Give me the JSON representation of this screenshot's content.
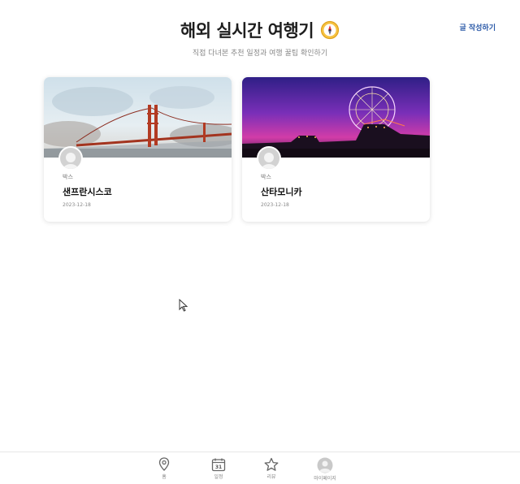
{
  "header": {
    "title": "해외 실시간 여행기",
    "subtitle": "직접 다녀본 추천 일정과 여행 꿀팁 확인하기",
    "write_link": "글 작성하기"
  },
  "cards": [
    {
      "author": "박스",
      "title": "샌프란시스코",
      "date": "2023-12-18"
    },
    {
      "author": "박스",
      "title": "산타모니카",
      "date": "2023-12-18"
    }
  ],
  "nav": [
    {
      "label": "홈",
      "icon": "map-pin-icon"
    },
    {
      "label": "일정",
      "icon": "calendar-icon"
    },
    {
      "label": "리뷰",
      "icon": "star-icon"
    },
    {
      "label": "마이페이지",
      "icon": "profile-icon"
    }
  ],
  "calendar_day": "31",
  "colors": {
    "accent": "#2b5aa8",
    "compass": "#f2b530"
  }
}
